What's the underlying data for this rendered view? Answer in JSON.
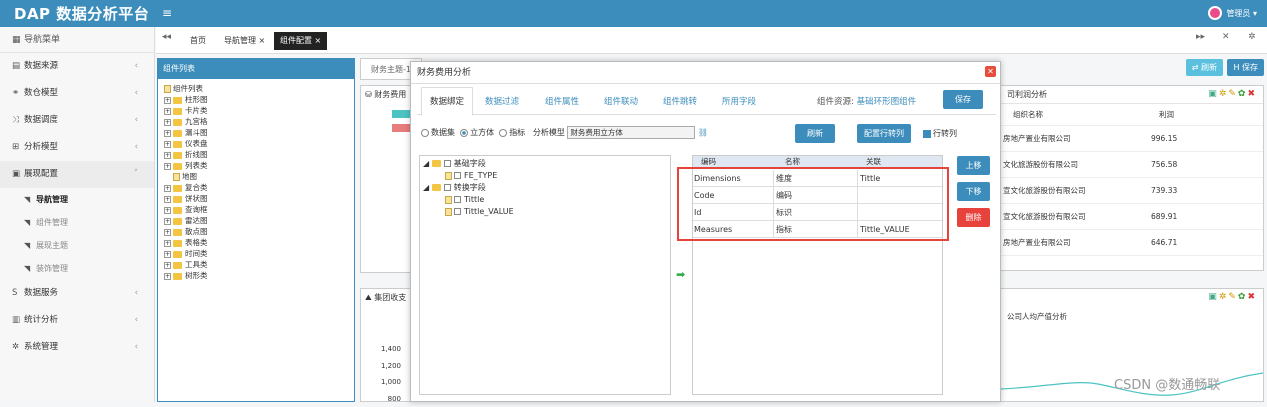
{
  "header": {
    "brand": "DAP 数据分析平台",
    "menu_icon": "hamburger-icon",
    "user": "管理员 ▾"
  },
  "sidebar": {
    "title": "导航菜单",
    "items": [
      {
        "label": "数据来源"
      },
      {
        "label": "数仓模型"
      },
      {
        "label": "数据调度"
      },
      {
        "label": "分析模型"
      },
      {
        "label": "展现配置"
      },
      {
        "label": "导航管理"
      },
      {
        "label": "组件管理"
      },
      {
        "label": "展现主题"
      },
      {
        "label": "装饰管理"
      },
      {
        "label": "数据服务"
      },
      {
        "label": "统计分析"
      },
      {
        "label": "系统管理"
      }
    ]
  },
  "tabs": {
    "home": "首页",
    "nav": "导航管理 ×",
    "config": "组件配置 ×"
  },
  "component_panel": {
    "title": "组件列表",
    "root": "组件列表",
    "nodes": [
      "柱形图",
      "卡片类",
      "九宫格",
      "漏斗图",
      "仪表盘",
      "折线图",
      "列表类",
      "地图",
      "复合类",
      "饼状图",
      "查询框",
      "雷达图",
      "散点图",
      "表格类",
      "时间类",
      "工具类",
      "树形类"
    ]
  },
  "background": {
    "tab": "财务主题-1",
    "refresh": "⇄ 刷新",
    "save": "H 保存",
    "chart1_title": "财务费用",
    "chart2_title": "集团收支",
    "yticks": [
      "1,400",
      "1,200",
      "1,000",
      "800"
    ],
    "right_title": "司利润分析",
    "right_cols": [
      "组织名称",
      "利润"
    ],
    "right_rows": [
      {
        "org": "房地产置业有限公司",
        "profit": "996.15"
      },
      {
        "org": "文化旅游股份有限公司",
        "profit": "756.58"
      },
      {
        "org": "宣文化旅游股份有限公司",
        "profit": "739.33"
      },
      {
        "org": "宣文化旅游股份有限公司",
        "profit": "689.91"
      },
      {
        "org": "房地产置业有限公司",
        "profit": "646.71"
      }
    ],
    "right2_title": "公司人均产值分析"
  },
  "modal": {
    "title": "财务费用分析",
    "tabs": [
      "数据绑定",
      "数据过滤",
      "组件属性",
      "组件联动",
      "组件跳转",
      "所用字段"
    ],
    "resource_label": "组件资源:",
    "resource_value": "基础环形图组件",
    "save": "保存",
    "radio_dataset": "数据集",
    "radio_cube": "立方体",
    "radio_metric": "指标",
    "model_label": "分析模型",
    "model_value": "财务费用立方体",
    "btn_refresh": "刷新",
    "btn_config": "配置行转列",
    "chk_row_to_col": "行转列",
    "tree": {
      "group1": "基础字段",
      "g1_fields": [
        "FE_TYPE"
      ],
      "group2": "转换字段",
      "g2_fields": [
        "Tittle",
        "Tittle_VALUE"
      ]
    },
    "table": {
      "headers": [
        "编码",
        "名称",
        "关联"
      ],
      "rows": [
        {
          "code": "Dimensions",
          "name": "维度",
          "link": "Tittle"
        },
        {
          "code": "Code",
          "name": "编码",
          "link": ""
        },
        {
          "code": "Id",
          "name": "标识",
          "link": ""
        },
        {
          "code": "Measures",
          "name": "指标",
          "link": "Tittle_VALUE"
        }
      ]
    },
    "btn_up": "上移",
    "btn_down": "下移",
    "btn_delete": "删除"
  },
  "watermark": "CSDN @数通畅联"
}
